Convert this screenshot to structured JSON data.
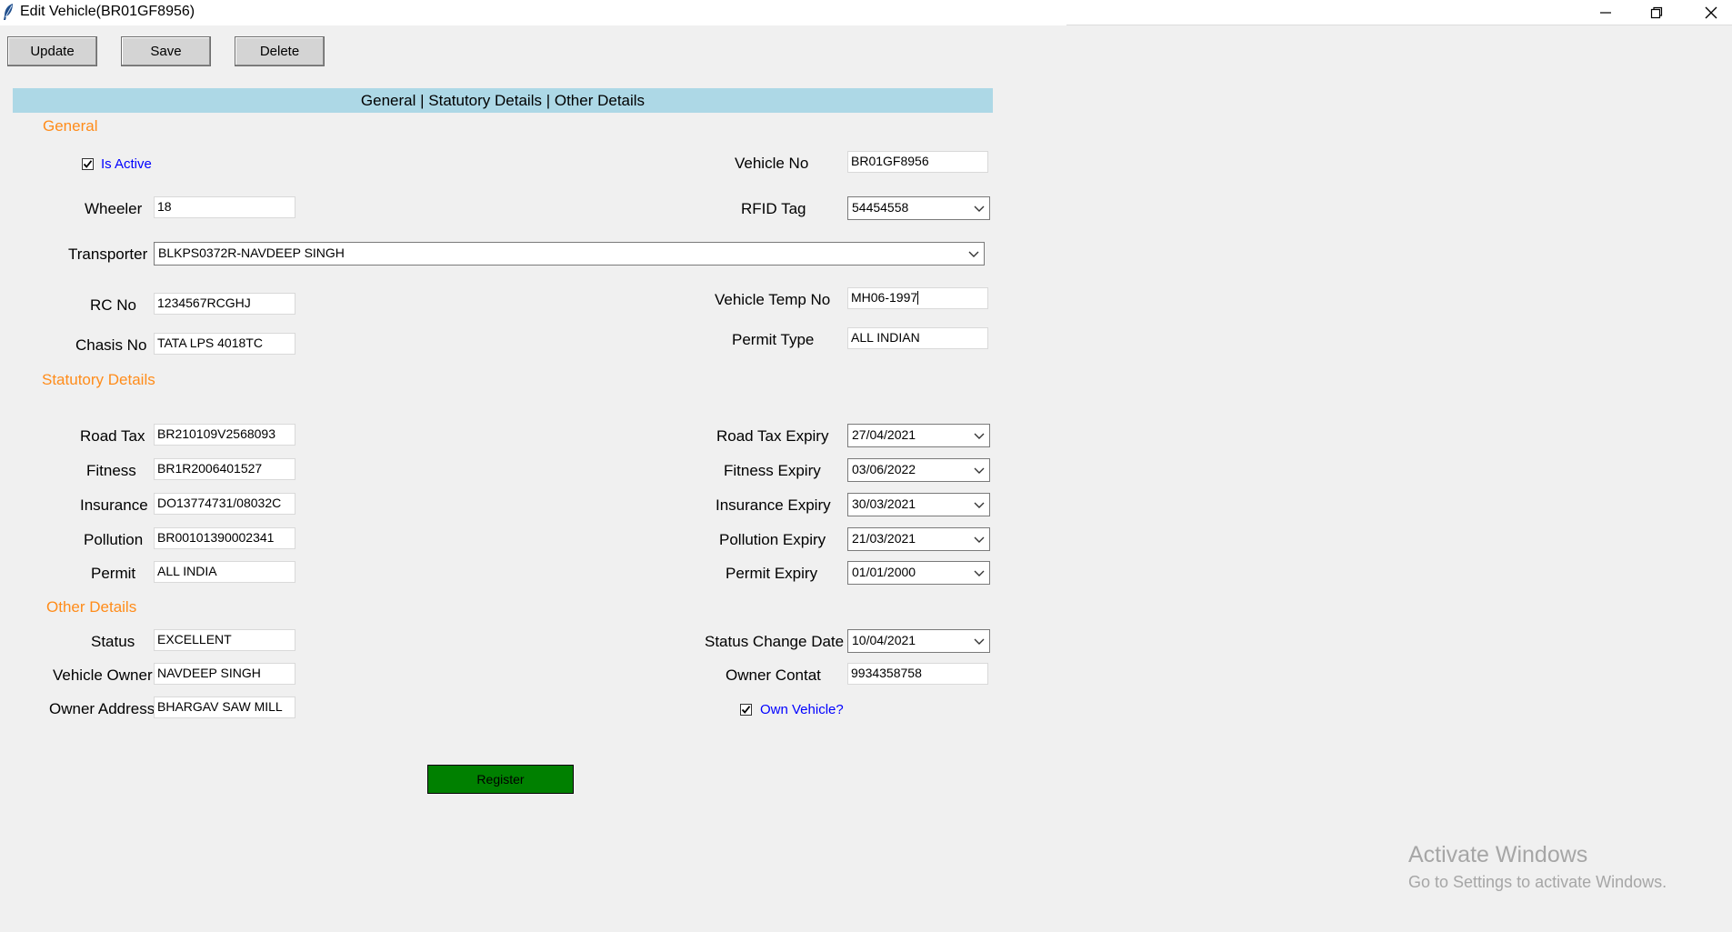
{
  "window": {
    "title": "Edit Vehicle(BR01GF8956)",
    "minimize_glyph": "—",
    "restore_glyph": "❐",
    "close_glyph": "✕"
  },
  "toolbar": {
    "update_label": "Update",
    "save_label": "Save",
    "delete_label": "Delete"
  },
  "tabs": {
    "label": "General | Statutory Details | Other Details"
  },
  "sections": {
    "general": "General",
    "statutory": "Statutory Details",
    "other": "Other Details"
  },
  "general": {
    "is_active_label": "Is Active",
    "is_active_checked": true,
    "vehicle_no_label": "Vehicle No",
    "vehicle_no": "BR01GF8956",
    "wheeler_label": "Wheeler",
    "wheeler": "18",
    "rfid_label": "RFID Tag",
    "rfid": "54454558",
    "transporter_label": "Transporter",
    "transporter": "BLKPS0372R-NAVDEEP SINGH",
    "rc_label": "RC No",
    "rc": "1234567RCGHJ",
    "temp_label": "Vehicle Temp No",
    "temp": "MH06-1997",
    "chasis_label": "Chasis No",
    "chasis": "TATA LPS 4018TC",
    "permit_type_label": "Permit Type",
    "permit_type": "ALL INDIAN"
  },
  "statutory": {
    "road_tax_label": "Road Tax",
    "road_tax": "BR210109V2568093",
    "road_tax_expiry_label": "Road Tax Expiry",
    "road_tax_expiry": "27/04/2021",
    "fitness_label": "Fitness",
    "fitness": "BR1R2006401527",
    "fitness_expiry_label": "Fitness Expiry",
    "fitness_expiry": "03/06/2022",
    "insurance_label": "Insurance",
    "insurance": "DO13774731/08032C",
    "insurance_expiry_label": "Insurance Expiry",
    "insurance_expiry": "30/03/2021",
    "pollution_label": "Pollution",
    "pollution": "BR00101390002341",
    "pollution_expiry_label": "Pollution Expiry",
    "pollution_expiry": "21/03/2021",
    "permit_label": "Permit",
    "permit": "ALL INDIA",
    "permit_expiry_label": "Permit Expiry",
    "permit_expiry": "01/01/2000"
  },
  "other": {
    "status_label": "Status",
    "status": "EXCELLENT",
    "status_change_label": "Status Change Date",
    "status_change": "10/04/2021",
    "owner_label": "Vehicle Owner",
    "owner": "NAVDEEP SINGH",
    "contact_label": "Owner Contat",
    "contact": "9934358758",
    "address_label": "Owner Address",
    "address": "BHARGAV SAW MILL",
    "own_vehicle_label": "Own Vehicle?",
    "own_vehicle_checked": true
  },
  "register_label": "Register",
  "watermark": {
    "line1": "Activate Windows",
    "line2": "Go to Settings to activate Windows."
  },
  "colors": {
    "tab_bar": "#add8e6",
    "section_heading": "#ff8c1a",
    "checkbox_label": "#0000ff",
    "register_button": "#008000"
  },
  "icons": [
    "feather-icon",
    "minimize-icon",
    "restore-icon",
    "close-icon",
    "chevron-down-icon",
    "checkmark-icon"
  ]
}
